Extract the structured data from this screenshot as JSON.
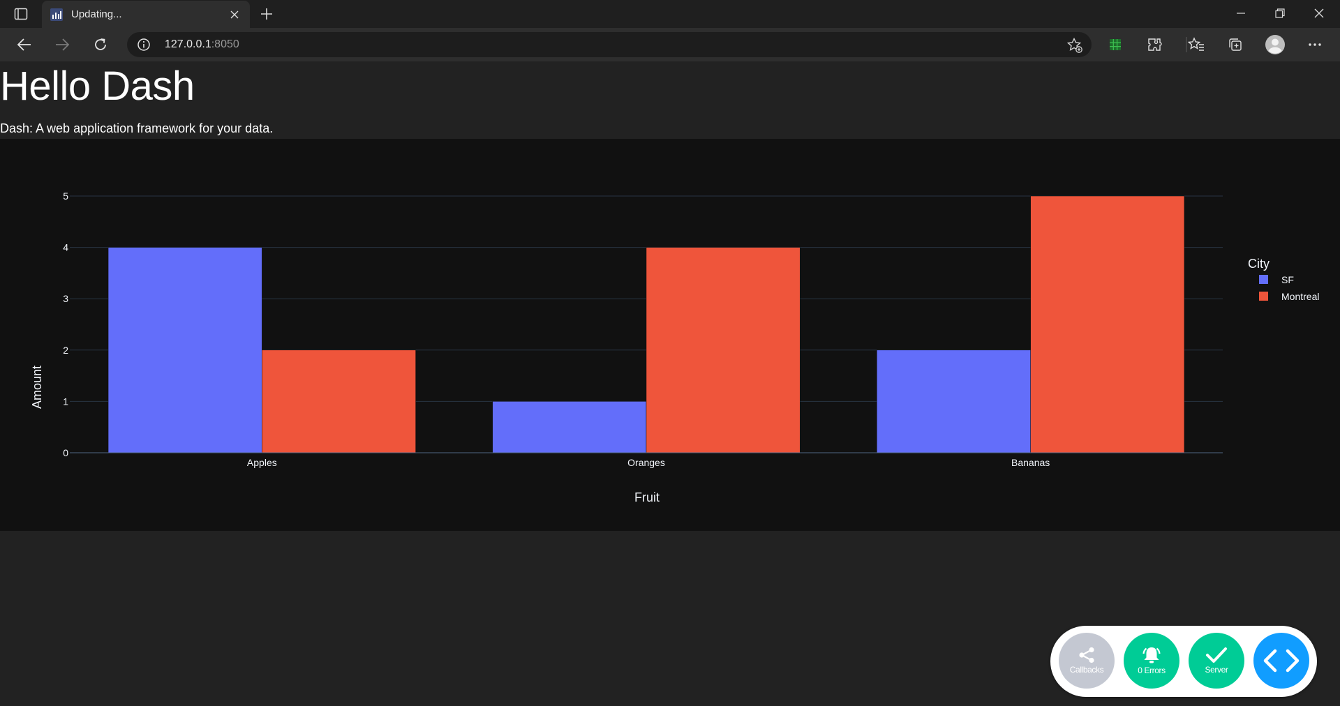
{
  "browser": {
    "tab_title": "Updating...",
    "url_host": "127.0.0.1",
    "url_port": ":8050"
  },
  "page": {
    "heading": "Hello Dash",
    "subtitle": "Dash: A web application framework for your data."
  },
  "chart_data": {
    "type": "bar",
    "categories": [
      "Apples",
      "Oranges",
      "Bananas"
    ],
    "series": [
      {
        "name": "SF",
        "values": [
          4,
          1,
          2
        ],
        "color": "#636efa"
      },
      {
        "name": "Montreal",
        "values": [
          2,
          4,
          5
        ],
        "color": "#ef553b"
      }
    ],
    "xlabel": "Fruit",
    "ylabel": "Amount",
    "legend_title": "City",
    "legend_position": "top-right",
    "ylim": [
      0,
      5
    ],
    "yticks": [
      0,
      1,
      2,
      3,
      4,
      5
    ],
    "grid": true,
    "barmode": "group"
  },
  "debug_menu": {
    "callbacks_label": "Callbacks",
    "errors_label": "0 Errors",
    "server_label": "Server",
    "colors": {
      "callbacks": "#c4c8d2",
      "errors": "#00cc96",
      "server": "#00cc96",
      "toggle": "#119dff"
    }
  }
}
